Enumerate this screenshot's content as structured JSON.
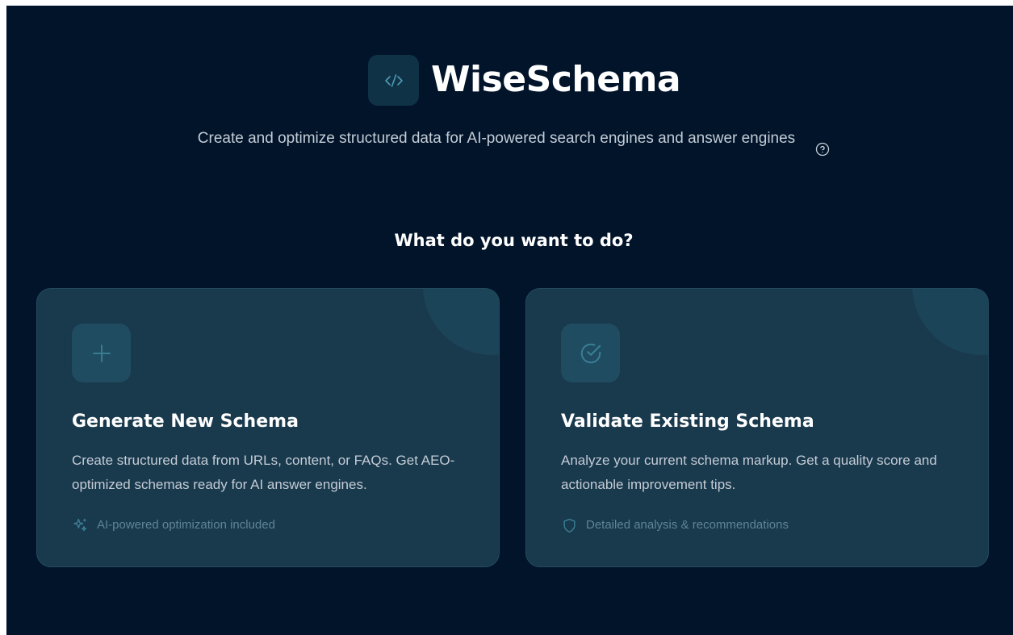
{
  "header": {
    "logo_icon": "code-brackets-icon",
    "app_title": "WiseSchema",
    "subtitle": "Create and optimize structured data for AI-powered search engines and answer engines",
    "help_icon": "help-circle-icon"
  },
  "prompt": {
    "question": "What do you want to do?"
  },
  "cards": [
    {
      "icon": "plus-icon",
      "title": "Generate New Schema",
      "description": "Create structured data from URLs, content, or FAQs. Get AEO-optimized schemas ready for AI answer engines.",
      "footer_icon": "sparkles-icon",
      "footer_text": "AI-powered optimization included"
    },
    {
      "icon": "check-circle-icon",
      "title": "Validate Existing Schema",
      "description": "Analyze your current schema markup. Get a quality score and actionable improvement tips.",
      "footer_icon": "shield-icon",
      "footer_text": "Detailed analysis & recommendations"
    }
  ],
  "colors": {
    "background": "#01142a",
    "card_background": "#19394d",
    "accent": "#3a7f96",
    "text_primary": "#ffffff",
    "text_secondary": "#c4ccd6",
    "text_muted": "#5f8596"
  }
}
